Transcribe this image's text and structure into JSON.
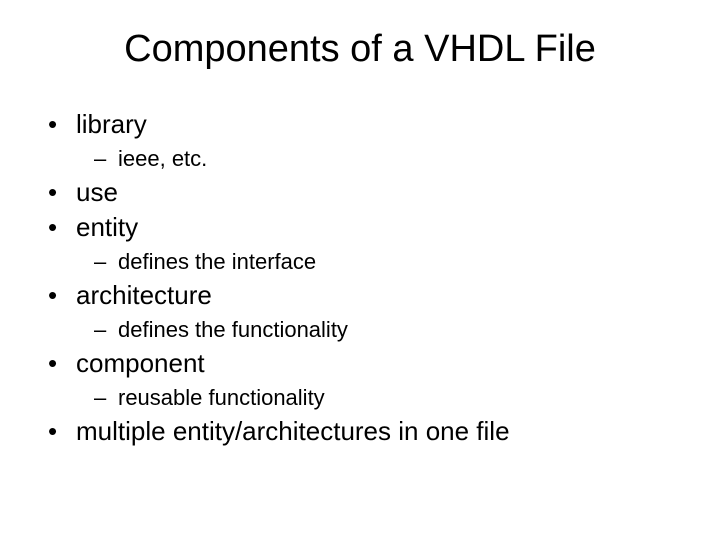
{
  "title": "Components of a VHDL File",
  "items": [
    {
      "label": "library",
      "sub": "ieee, etc."
    },
    {
      "label": "use",
      "sub": null
    },
    {
      "label": "entity",
      "sub": "defines the interface"
    },
    {
      "label": "architecture",
      "sub": "defines the functionality"
    },
    {
      "label": "component",
      "sub": "reusable functionality"
    },
    {
      "label": "multiple entity/architectures in one file",
      "sub": null
    }
  ]
}
